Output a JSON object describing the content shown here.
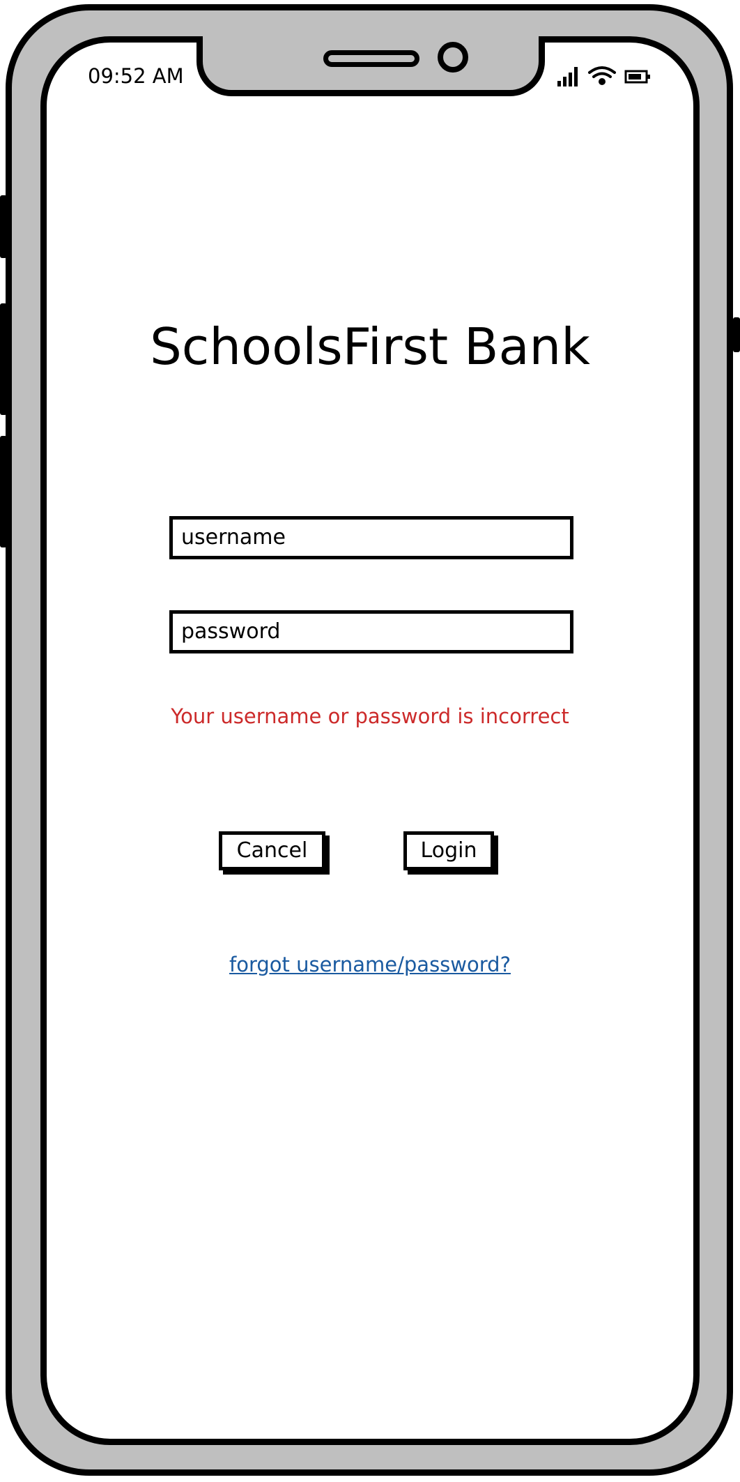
{
  "status_bar": {
    "time": "09:52 AM",
    "icons": [
      "signal-icon",
      "wifi-icon",
      "battery-icon"
    ]
  },
  "app": {
    "title": "SchoolsFirst Bank"
  },
  "form": {
    "username_placeholder": "username",
    "password_placeholder": "password",
    "error_message": "Your username or password is incorrect"
  },
  "buttons": {
    "cancel_label": "Cancel",
    "login_label": "Login"
  },
  "links": {
    "forgot_label": "forgot username/password?"
  },
  "colors": {
    "frame": "#bfbfbf",
    "error": "#cc2a2a",
    "link": "#1a5aa0"
  }
}
